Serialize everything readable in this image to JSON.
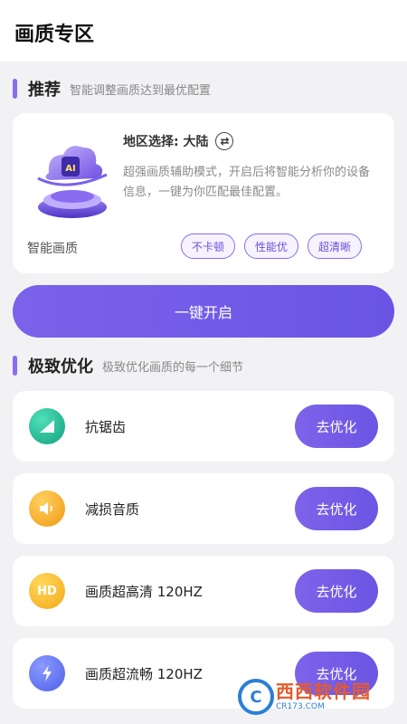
{
  "page": {
    "title": "画质专区"
  },
  "recommend": {
    "section_title": "推荐",
    "section_subtitle": "智能调整画质达到最优配置",
    "ai_label": "智能画质",
    "region_label": "地区选择: 大陆",
    "description": "超强画质辅助模式，开启后将智能分析你的设备信息，一键为你匹配最佳配置。",
    "tags": [
      "不卡顿",
      "性能优",
      "超清晰"
    ],
    "start_button": "一键开启"
  },
  "optimize": {
    "section_title": "极致优化",
    "section_subtitle": "极致优化画质的每一个细节",
    "items": [
      {
        "label": "抗锯齿",
        "icon": "signal-bars-icon",
        "button": "去优化",
        "color": "#19b38f"
      },
      {
        "label": "减损音质",
        "icon": "speaker-icon",
        "button": "去优化",
        "color": "#f2a623"
      },
      {
        "label": "画质超高清 120HZ",
        "icon": "hd-icon",
        "icon_text": "HD",
        "button": "去优化",
        "color": "#f5b820"
      },
      {
        "label": "画质超流畅 120HZ",
        "icon": "lightning-icon",
        "button": "去优化",
        "color": "#5d6ef0"
      }
    ]
  },
  "watermark": {
    "main": "西西软件园",
    "sub": "CR173.COM"
  },
  "colors": {
    "accent": "#7b62ea",
    "background": "#f2f2f5"
  }
}
